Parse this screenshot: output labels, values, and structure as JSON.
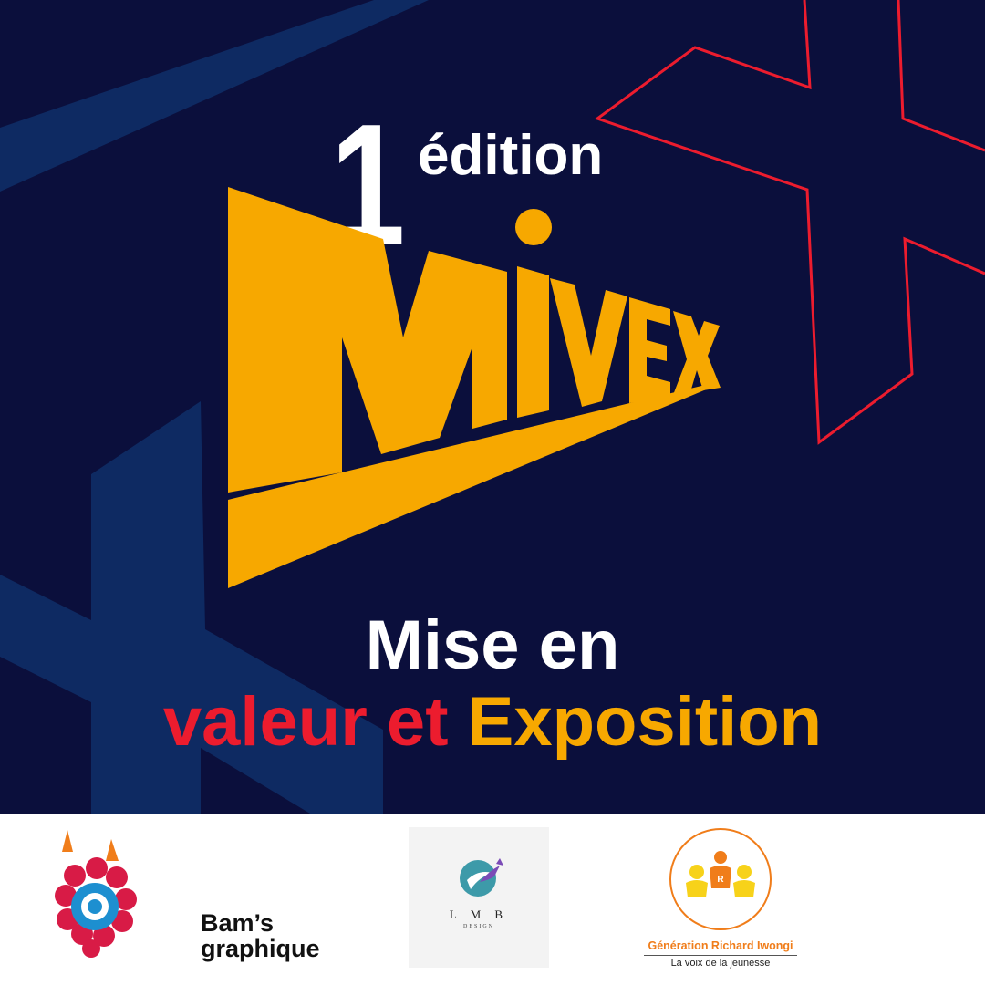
{
  "edition": {
    "number": "1",
    "word": "édition"
  },
  "event": {
    "name": "MIVEX"
  },
  "tagline": {
    "line1": "Mise en",
    "line2_part1": "valeur et",
    "line2_part2": "Exposition"
  },
  "sponsors": [
    {
      "name": "Bam’s graphique",
      "line1": "Bam’s",
      "line2": "graphique"
    },
    {
      "name": "LMB DESIGN",
      "line1": "L M B",
      "line2": "DESIGN"
    },
    {
      "name": "Génération Richard Iwongi",
      "line1": "Génération Richard Iwongi",
      "line2": "La voix de la jeunesse"
    }
  ],
  "colors": {
    "background": "#0b0f3c",
    "accent_gold": "#f7a800",
    "accent_red": "#ec1c2e",
    "deco_blue": "#0e2a62",
    "white": "#ffffff"
  },
  "icons": [
    "bams-graphique-logo-icon",
    "lmb-design-logo-icon",
    "generation-richard-iwongi-logo-icon"
  ]
}
